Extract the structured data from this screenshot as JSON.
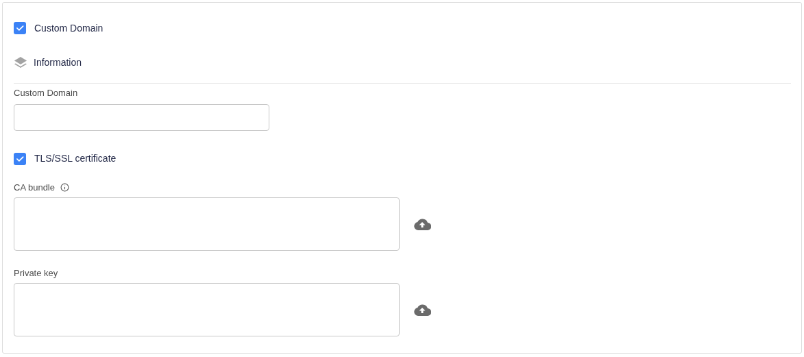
{
  "custom_domain_toggle": {
    "label": "Custom Domain",
    "checked": true
  },
  "section": {
    "title": "Information"
  },
  "domain_field": {
    "label": "Custom Domain"
  },
  "tls_toggle": {
    "label": "TLS/SSL certificate",
    "checked": true
  },
  "file_fields": [
    {
      "label": "CA bundle",
      "info": true
    },
    {
      "label": "Private key",
      "info": false
    }
  ]
}
